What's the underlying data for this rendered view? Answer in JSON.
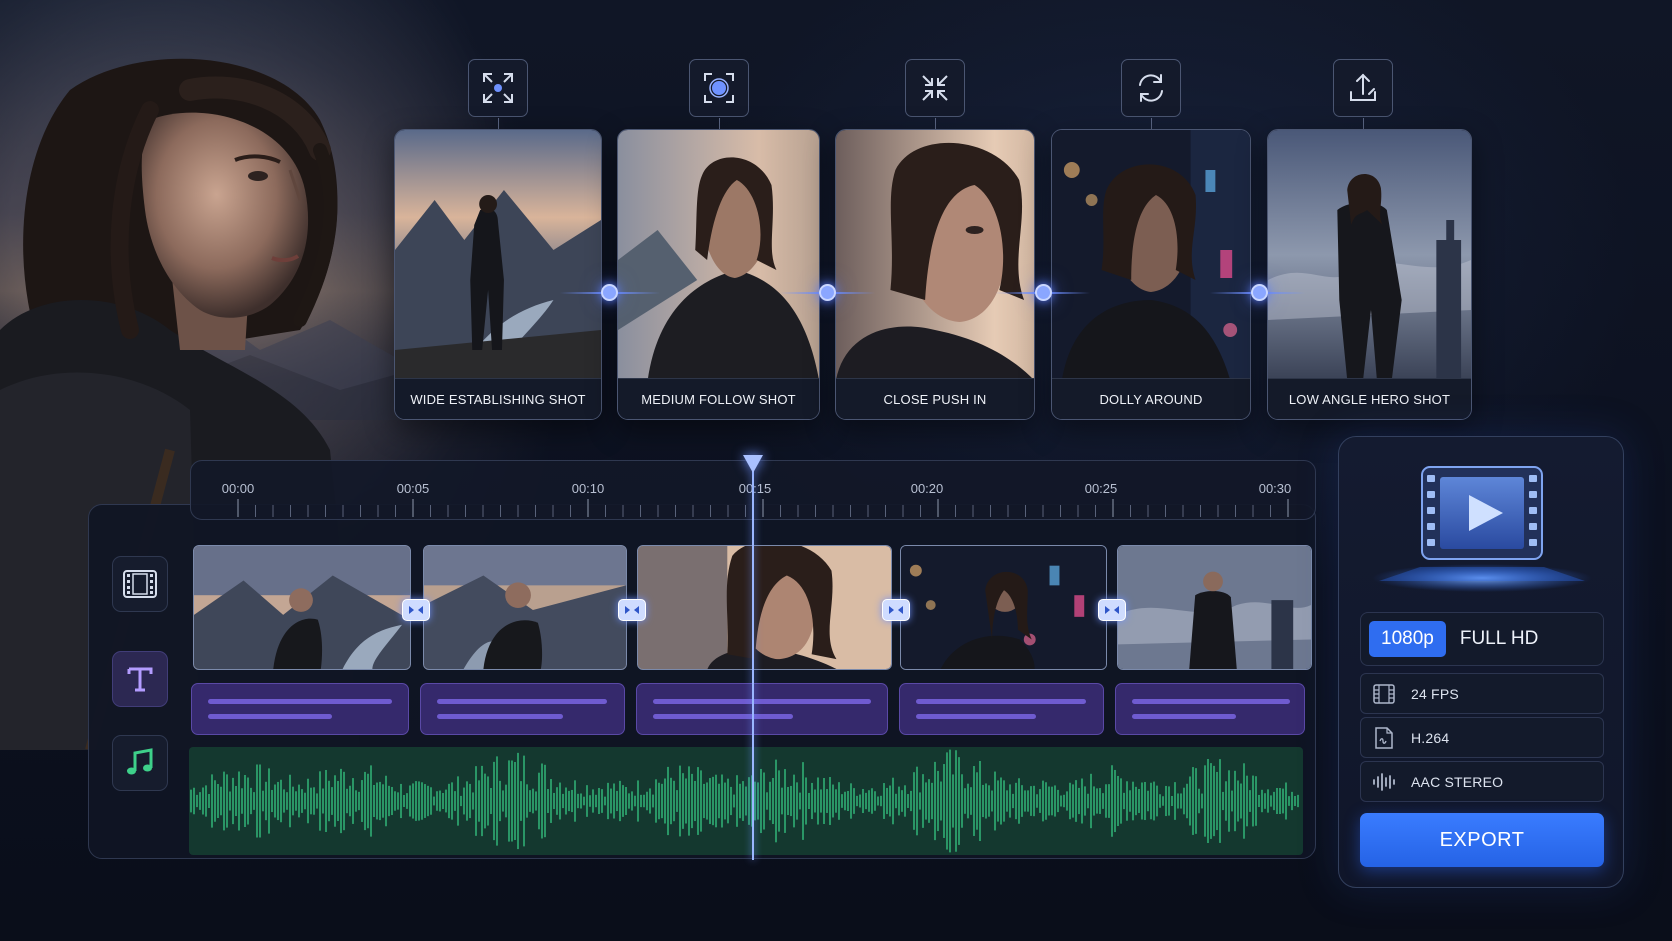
{
  "shots": [
    {
      "label": "WIDE ESTABLISHING SHOT",
      "icon": "expand-arrows-icon"
    },
    {
      "label": "MEDIUM FOLLOW SHOT",
      "icon": "focus-target-icon"
    },
    {
      "label": "CLOSE PUSH IN",
      "icon": "compress-arrows-icon"
    },
    {
      "label": "DOLLY AROUND",
      "icon": "rotate-arrows-icon"
    },
    {
      "label": "LOW ANGLE HERO SHOT",
      "icon": "tilt-up-icon"
    }
  ],
  "timeline": {
    "ticks": [
      "00:00",
      "00:05",
      "00:10",
      "00:15",
      "00:20",
      "00:25",
      "00:30"
    ],
    "playhead_time": "00:15",
    "tracks": [
      "video-track-icon",
      "text-track-icon",
      "music-track-icon"
    ]
  },
  "export": {
    "resolution_badge": "1080p",
    "resolution_label": "FULL HD",
    "specs": [
      {
        "label": "24 FPS",
        "icon": "film-frame-icon"
      },
      {
        "label": "H.264",
        "icon": "codec-file-icon"
      },
      {
        "label": "AAC STEREO",
        "icon": "audio-wave-icon"
      }
    ],
    "button_label": "EXPORT"
  },
  "colors": {
    "accent_blue": "#2f6df0",
    "text_track": "#35296c",
    "audio_wave": "#2fae74",
    "background": "#0b0f1c"
  }
}
